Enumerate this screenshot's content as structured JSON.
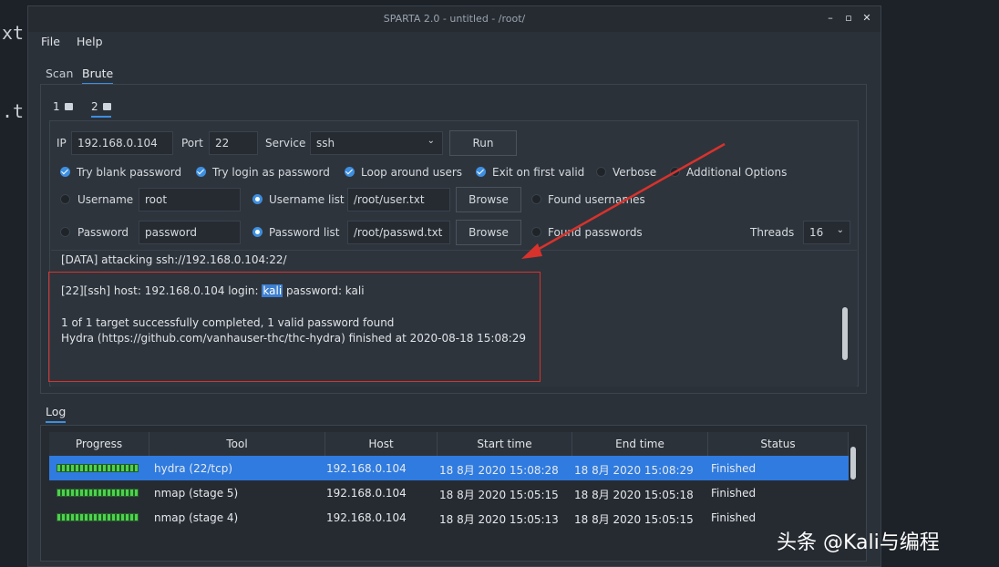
{
  "background": {
    "left_text_1": "xt",
    "left_text_2": ".t"
  },
  "window": {
    "title": "SPARTA 2.0 - untitled - /root/",
    "controls": [
      "–",
      "▫",
      "✕"
    ]
  },
  "menu": [
    "File",
    "Help"
  ],
  "top_tabs": [
    "Scan",
    "Brute"
  ],
  "brute_tabs": [
    "1",
    "2"
  ],
  "form": {
    "ip_label": "IP",
    "ip_value": "192.168.0.104",
    "port_label": "Port",
    "port_value": "22",
    "service_label": "Service",
    "service_value": "ssh",
    "run_label": "Run",
    "options": [
      {
        "label": "Try blank password",
        "checked": true
      },
      {
        "label": "Try login as password",
        "checked": true
      },
      {
        "label": "Loop around users",
        "checked": true
      },
      {
        "label": "Exit on first valid",
        "checked": true
      },
      {
        "label": "Verbose",
        "checked": false
      },
      {
        "label": "Additional Options",
        "checked": false
      }
    ],
    "username_label": "Username",
    "username_value": "root",
    "username_list_label": "Username list",
    "username_list_value": "/root/user.txt",
    "browse_label": "Browse",
    "found_usernames_label": "Found usernames",
    "password_label": "Password",
    "password_value": "password",
    "password_list_label": "Password list",
    "password_list_value": "/root/passwd.txt",
    "found_passwords_label": "Found passwords",
    "threads_label": "Threads",
    "threads_value": "16"
  },
  "output": {
    "line1": "[DATA] attacking ssh://192.168.0.104:22/",
    "line2_pre": "[22][ssh] host: 192.168.0.104   login: ",
    "line2_hl": "kali",
    "line2_post": "   password: kali",
    "line3": "1 of 1 target successfully completed, 1 valid password found",
    "line4": "Hydra (https://github.com/vanhauser-thc/thc-hydra) finished at 2020-08-18 15:08:29"
  },
  "log": {
    "tab_label": "Log",
    "columns": [
      "Progress",
      "Tool",
      "Host",
      "Start time",
      "End time",
      "Status"
    ],
    "rows": [
      {
        "progress": 1.0,
        "tool": "hydra (22/tcp)",
        "host": "192.168.0.104",
        "start": "18 8月 2020 15:08:28",
        "end": "18 8月 2020 15:08:29",
        "status": "Finished",
        "selected": true
      },
      {
        "progress": 1.0,
        "tool": "nmap (stage 5)",
        "host": "192.168.0.104",
        "start": "18 8月 2020 15:05:15",
        "end": "18 8月 2020 15:05:18",
        "status": "Finished",
        "selected": false
      },
      {
        "progress": 1.0,
        "tool": "nmap (stage 4)",
        "host": "192.168.0.104",
        "start": "18 8月 2020 15:05:13",
        "end": "18 8月 2020 15:05:15",
        "status": "Finished",
        "selected": false
      }
    ]
  },
  "watermark": "头条 @Kali与编程",
  "colors": {
    "accent": "#3d8fe0",
    "annotation": "#d8322c",
    "progress": "#4ed24e"
  }
}
